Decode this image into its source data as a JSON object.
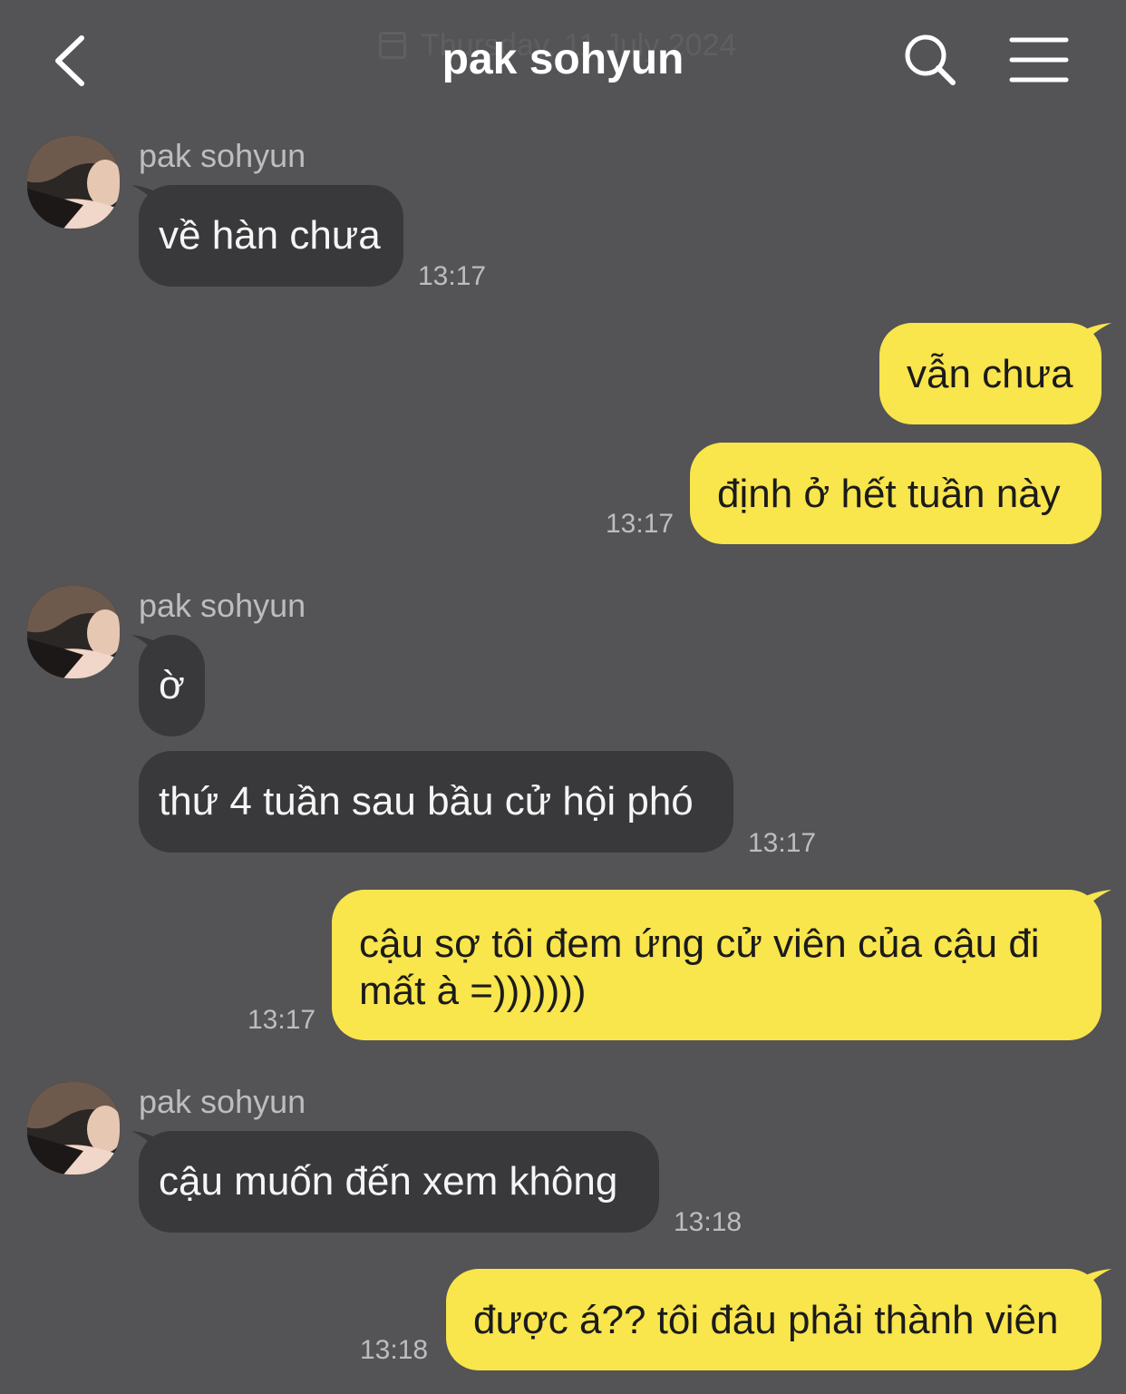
{
  "header": {
    "date": "Thursday, 11 July 2024",
    "title": "pak sohyun"
  },
  "colors": {
    "background": "#545355",
    "incoming_bubble": "#39383a",
    "outgoing_bubble": "#f9e54c"
  },
  "messages": [
    {
      "sender": "pak sohyun",
      "text": "về hàn chưa",
      "time": "13:17"
    },
    {
      "text": "vẫn chưa"
    },
    {
      "text": "định ở hết tuần này",
      "time": "13:17"
    },
    {
      "sender": "pak sohyun",
      "text": "ờ"
    },
    {
      "text": "thứ 4 tuần sau bầu cử hội phó",
      "time": "13:17"
    },
    {
      "line1": "cậu sợ tôi đem ứng cử viên của cậu đi",
      "line2": "mất à =)))))))",
      "time": "13:17"
    },
    {
      "sender": "pak sohyun",
      "text": "cậu muốn đến xem không",
      "time": "13:18"
    },
    {
      "text": "được á?? tôi đâu phải thành viên",
      "time": "13:18"
    }
  ]
}
